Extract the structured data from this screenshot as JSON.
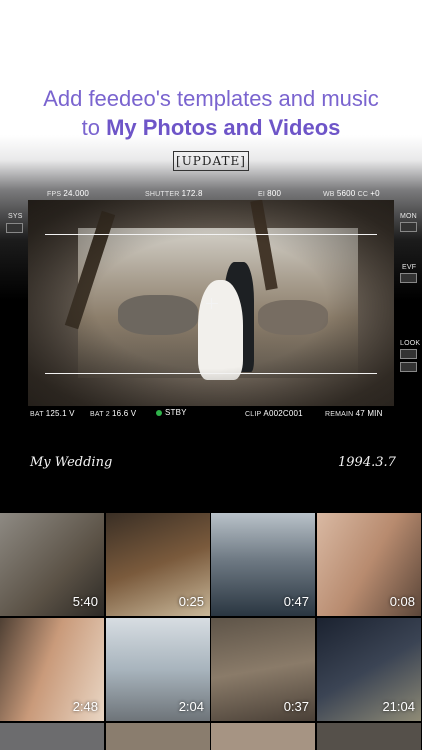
{
  "headline": {
    "line1": "Add feedeo's templates and music",
    "line2_prefix": "to ",
    "line2_bold": "My Photos and Videos"
  },
  "update_label": "[UPDATE]",
  "hud": {
    "fps_label": "FPS",
    "fps_value": "24.000",
    "shutter_label": "SHUTTER",
    "shutter_value": "172.8",
    "ei_label": "EI",
    "ei_value": "800",
    "wb_label": "WB",
    "wb_value": "5600",
    "cc_label": "CC",
    "cc_value": "+0",
    "sys_label": "SYS",
    "mon_label": "MON",
    "evf_label": "EVF",
    "look_label": "LOOK",
    "bat_label": "BAT",
    "bat_value": "125.1 V",
    "bat2_label": "BAT 2",
    "bat2_value": "16.6 V",
    "stby_label": "STBY",
    "clip_label": "CLIP",
    "clip_value": "A002C001",
    "remain_label": "REMAIN",
    "remain_value": "47 MIN"
  },
  "caption_left": "My Wedding",
  "caption_right": "1994.3.7",
  "tiles": [
    {
      "duration": "5:40"
    },
    {
      "duration": "0:25"
    },
    {
      "duration": "0:47"
    },
    {
      "duration": "0:08"
    },
    {
      "duration": "2:48"
    },
    {
      "duration": "2:04"
    },
    {
      "duration": "0:37"
    },
    {
      "duration": "21:04"
    }
  ],
  "colors": {
    "accent": "#7a64cf",
    "standby_green": "#3fc25a"
  }
}
